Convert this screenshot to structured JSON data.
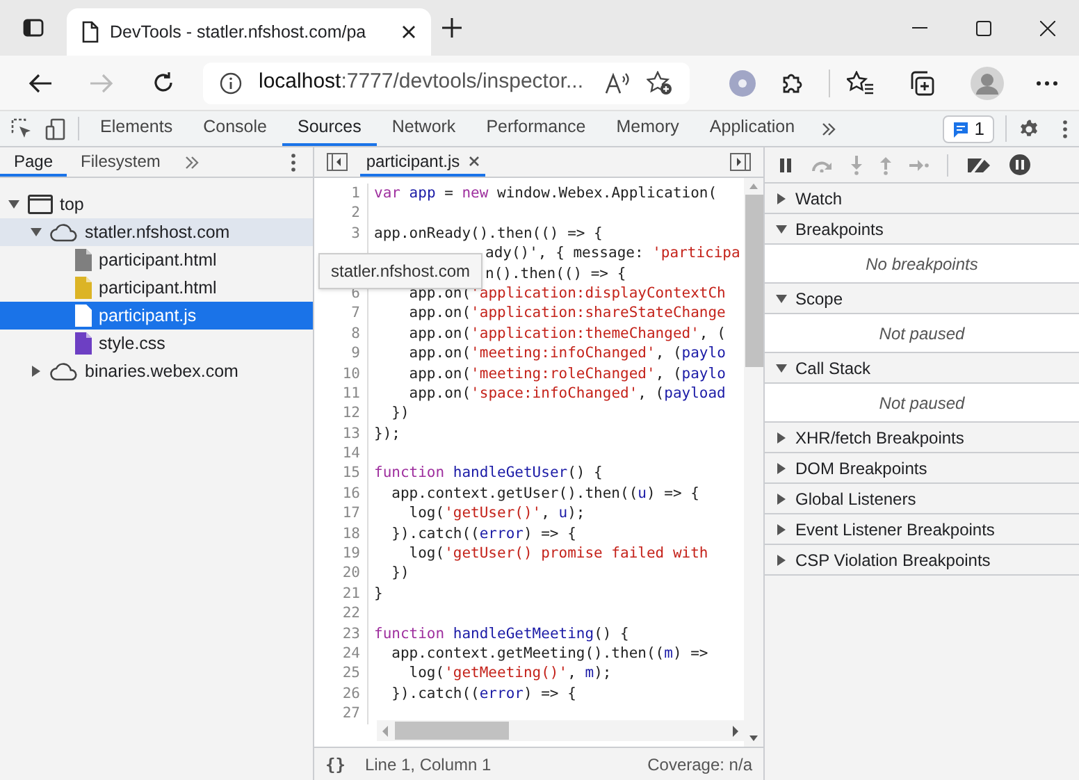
{
  "browser": {
    "tab_title": "DevTools - statler.nfshost.com/pa",
    "url_host": "localhost",
    "url_rest": ":7777/devtools/inspector..."
  },
  "devtools_tabs": [
    {
      "label": "Elements",
      "selected": false
    },
    {
      "label": "Console",
      "selected": false
    },
    {
      "label": "Sources",
      "selected": true
    },
    {
      "label": "Network",
      "selected": false
    },
    {
      "label": "Performance",
      "selected": false
    },
    {
      "label": "Memory",
      "selected": false
    },
    {
      "label": "Application",
      "selected": false
    }
  ],
  "issues_badge": "1",
  "navigator": {
    "tabs": [
      {
        "label": "Page",
        "selected": true
      },
      {
        "label": "Filesystem",
        "selected": false
      }
    ],
    "tree": [
      {
        "label": "top",
        "kind": "frame",
        "expanded": true,
        "selected": false,
        "children": [
          {
            "label": "statler.nfshost.com",
            "kind": "domain",
            "expanded": true,
            "selected": false,
            "hovered": true,
            "children": [
              {
                "label": "participant.html",
                "kind": "file",
                "color": "#7f7f7f",
                "selected": false
              },
              {
                "label": "participant.html",
                "kind": "file",
                "color": "#dcb425",
                "selected": false
              },
              {
                "label": "participant.js",
                "kind": "file",
                "color": "#ffffff",
                "selected": true
              },
              {
                "label": "style.css",
                "kind": "file",
                "color": "#6d3fc3",
                "selected": false
              }
            ]
          },
          {
            "label": "binaries.webex.com",
            "kind": "domain",
            "expanded": false,
            "selected": false
          }
        ]
      }
    ]
  },
  "editor": {
    "tab": "participant.js",
    "tooltip": "statler.nfshost.com",
    "lines": [
      {
        "n": "1",
        "tokens": [
          {
            "kind": "keyword",
            "text": "var "
          },
          {
            "kind": "name",
            "text": "app"
          },
          {
            "kind": "plain",
            "text": " = "
          },
          {
            "kind": "keyword",
            "text": "new"
          },
          {
            "kind": "plain",
            "text": " window.Webex.Application("
          }
        ]
      },
      {
        "n": "2"
      },
      {
        "n": "3",
        "tokens": [
          {
            "kind": "plain",
            "text": "app.onReady().then(() => {"
          }
        ]
      },
      {
        "tokens": [
          {
            "kind": "plain",
            "text": "ady()', { message: "
          },
          {
            "kind": "string",
            "text": "'participa"
          }
        ]
      },
      {
        "tokens": [
          {
            "kind": "plain",
            "text": "n().then(() => {"
          }
        ]
      },
      {
        "n": "6",
        "tokens": [
          {
            "kind": "plain",
            "text": "    app.on("
          },
          {
            "kind": "string",
            "text": "'application:displayContextCh"
          }
        ]
      },
      {
        "n": "7",
        "tokens": [
          {
            "kind": "plain",
            "text": "    app.on("
          },
          {
            "kind": "string",
            "text": "'application:shareStateChange"
          }
        ]
      },
      {
        "n": "8",
        "tokens": [
          {
            "kind": "plain",
            "text": "    app.on("
          },
          {
            "kind": "string",
            "text": "'application:themeChanged'"
          },
          {
            "kind": "plain",
            "text": ", ("
          }
        ]
      },
      {
        "n": "9",
        "tokens": [
          {
            "kind": "plain",
            "text": "    app.on("
          },
          {
            "kind": "string",
            "text": "'meeting:infoChanged'"
          },
          {
            "kind": "plain",
            "text": ", ("
          },
          {
            "kind": "name",
            "text": "paylo"
          }
        ]
      },
      {
        "n": "10",
        "tokens": [
          {
            "kind": "plain",
            "text": "    app.on("
          },
          {
            "kind": "string",
            "text": "'meeting:roleChanged'"
          },
          {
            "kind": "plain",
            "text": ", ("
          },
          {
            "kind": "name",
            "text": "paylo"
          }
        ]
      },
      {
        "n": "11",
        "tokens": [
          {
            "kind": "plain",
            "text": "    app.on("
          },
          {
            "kind": "string",
            "text": "'space:infoChanged'"
          },
          {
            "kind": "plain",
            "text": ", ("
          },
          {
            "kind": "name",
            "text": "payload"
          }
        ]
      },
      {
        "n": "12",
        "tokens": [
          {
            "kind": "plain",
            "text": "  })"
          }
        ]
      },
      {
        "n": "13",
        "tokens": [
          {
            "kind": "plain",
            "text": "});"
          }
        ]
      },
      {
        "n": "14"
      },
      {
        "n": "15",
        "tokens": [
          {
            "kind": "keyword",
            "text": "function "
          },
          {
            "kind": "name",
            "text": "handleGetUser"
          },
          {
            "kind": "plain",
            "text": "() {"
          }
        ]
      },
      {
        "n": "16",
        "tokens": [
          {
            "kind": "plain",
            "text": "  app.context.getUser().then(("
          },
          {
            "kind": "name",
            "text": "u"
          },
          {
            "kind": "plain",
            "text": ") => {"
          }
        ]
      },
      {
        "n": "17",
        "tokens": [
          {
            "kind": "plain",
            "text": "    log("
          },
          {
            "kind": "string",
            "text": "'getUser()'"
          },
          {
            "kind": "plain",
            "text": ", "
          },
          {
            "kind": "name",
            "text": "u"
          },
          {
            "kind": "plain",
            "text": ");"
          }
        ]
      },
      {
        "n": "18",
        "tokens": [
          {
            "kind": "plain",
            "text": "  }).catch(("
          },
          {
            "kind": "name",
            "text": "error"
          },
          {
            "kind": "plain",
            "text": ") => {"
          }
        ]
      },
      {
        "n": "19",
        "tokens": [
          {
            "kind": "plain",
            "text": "    log("
          },
          {
            "kind": "string",
            "text": "'getUser() promise failed with"
          }
        ]
      },
      {
        "n": "20",
        "tokens": [
          {
            "kind": "plain",
            "text": "  })"
          }
        ]
      },
      {
        "n": "21",
        "tokens": [
          {
            "kind": "plain",
            "text": "}"
          }
        ]
      },
      {
        "n": "22"
      },
      {
        "n": "23",
        "tokens": [
          {
            "kind": "keyword",
            "text": "function "
          },
          {
            "kind": "name",
            "text": "handleGetMeeting"
          },
          {
            "kind": "plain",
            "text": "() {"
          }
        ]
      },
      {
        "n": "24",
        "tokens": [
          {
            "kind": "plain",
            "text": "  app.context.getMeeting().then(("
          },
          {
            "kind": "name",
            "text": "m"
          },
          {
            "kind": "plain",
            "text": ") =>"
          }
        ]
      },
      {
        "n": "25",
        "tokens": [
          {
            "kind": "plain",
            "text": "    log("
          },
          {
            "kind": "string",
            "text": "'getMeeting()'"
          },
          {
            "kind": "plain",
            "text": ", "
          },
          {
            "kind": "name",
            "text": "m"
          },
          {
            "kind": "plain",
            "text": ");"
          }
        ]
      },
      {
        "n": "26",
        "tokens": [
          {
            "kind": "plain",
            "text": "  }).catch(("
          },
          {
            "kind": "name",
            "text": "error"
          },
          {
            "kind": "plain",
            "text": ") => {"
          }
        ]
      },
      {
        "n": "27"
      }
    ],
    "pretty_print": "{}",
    "status_position": "Line 1, Column 1",
    "status_coverage": "Coverage: n/a"
  },
  "debugger": {
    "sections": [
      {
        "title": "Watch",
        "expanded": false
      },
      {
        "title": "Breakpoints",
        "expanded": true,
        "message": "No breakpoints"
      },
      {
        "title": "Scope",
        "expanded": true,
        "message": "Not paused"
      },
      {
        "title": "Call Stack",
        "expanded": true,
        "message": "Not paused"
      },
      {
        "title": "XHR/fetch Breakpoints",
        "expanded": false
      },
      {
        "title": "DOM Breakpoints",
        "expanded": false
      },
      {
        "title": "Global Listeners",
        "expanded": false
      },
      {
        "title": "Event Listener Breakpoints",
        "expanded": false
      },
      {
        "title": "CSP Violation Breakpoints",
        "expanded": false
      }
    ]
  }
}
